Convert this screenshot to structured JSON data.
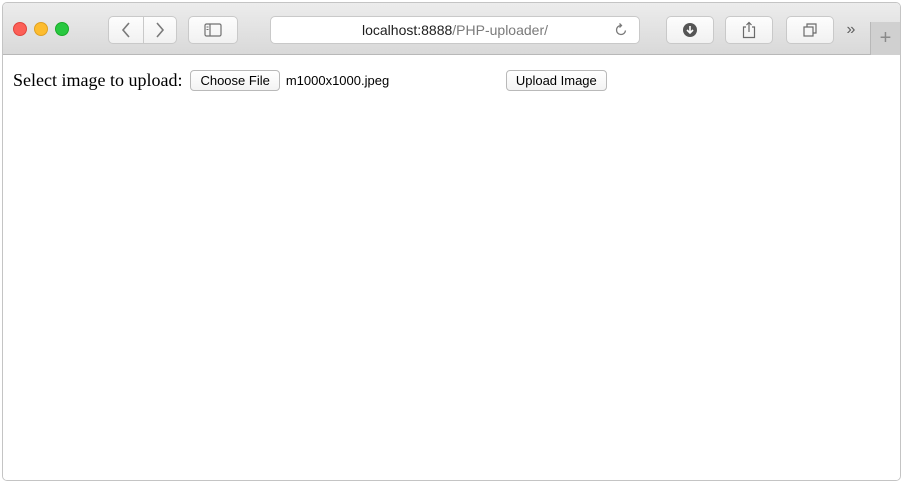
{
  "browser": {
    "url_host": "localhost:8888",
    "url_path": "/PHP-uploader/",
    "overflow_label": "»",
    "new_tab_label": "+"
  },
  "form": {
    "label": "Select image to upload:",
    "choose_file_label": "Choose File",
    "selected_file": "m1000x1000.jpeg",
    "submit_label": "Upload Image"
  },
  "colors": {
    "close": "#fc5f57",
    "minimize": "#fdbc2e",
    "maximize": "#28c840"
  }
}
